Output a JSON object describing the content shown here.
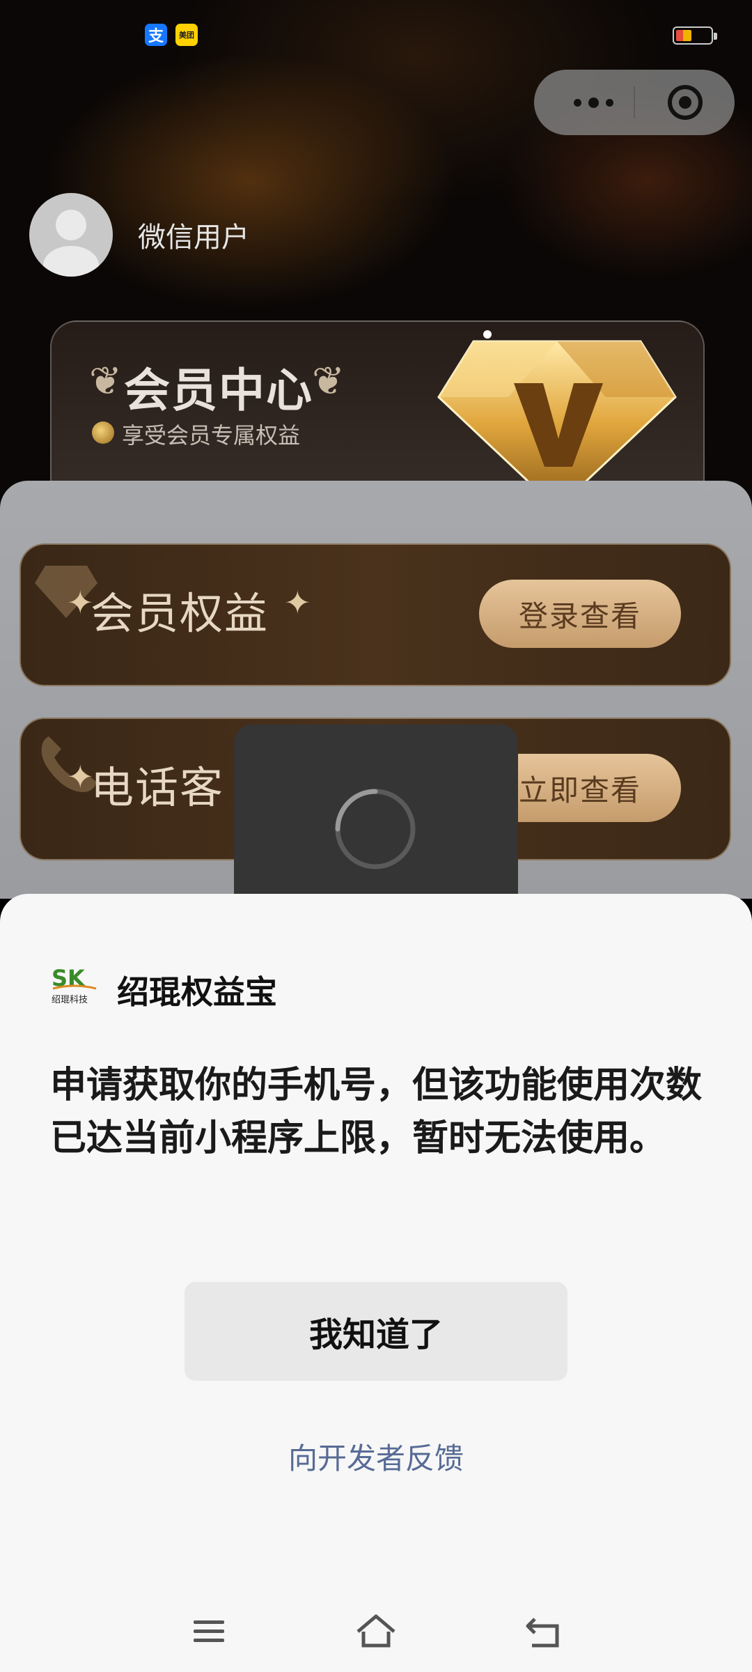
{
  "status_bar": {
    "app_icons": [
      "alipay-icon",
      "meituan-icon"
    ],
    "alipay_glyph": "支",
    "meituan_glyph": "美团",
    "battery_icon": "battery-low-icon"
  },
  "capsule": {
    "menu_icon": "more-dots-icon",
    "close_icon": "target-close-icon"
  },
  "profile": {
    "avatar_icon": "default-avatar-icon",
    "username": "微信用户"
  },
  "member_card": {
    "title": "会员中心",
    "subtitle": "享受会员专属权益",
    "badge_icon": "v-diamond-icon"
  },
  "rows": [
    {
      "title": "会员权益",
      "button": "登录查看",
      "icon": "diamond-outline-icon"
    },
    {
      "title": "电话客",
      "button": "立即查看",
      "icon": "phone-icon"
    }
  ],
  "loading_toast": {
    "icon": "spinner-icon"
  },
  "dialog": {
    "app_name": "绍琨权益宝",
    "logo_letters": "SK",
    "logo_caption": "绍琨科技",
    "message": "申请获取你的手机号，但该功能使用次数已达当前小程序上限，暂时无法使用。",
    "ok_button": "我知道了",
    "feedback_link": "向开发者反馈"
  },
  "nav_bar": {
    "items": [
      "menu-icon",
      "home-icon",
      "back-icon"
    ]
  },
  "colors": {
    "dialog_bg": "#f7f7f7",
    "link": "#576b95",
    "gold_button": "#d9b486",
    "toast_bg": "#353535"
  }
}
